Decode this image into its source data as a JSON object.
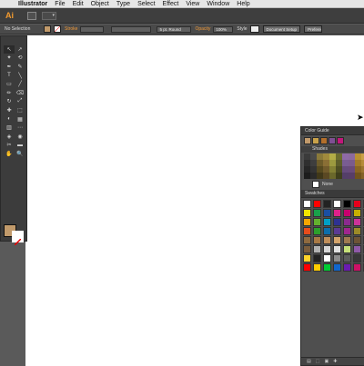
{
  "menubar": {
    "apple_glyph": "",
    "items": [
      "Illustrator",
      "File",
      "Edit",
      "Object",
      "Type",
      "Select",
      "Effect",
      "View",
      "Window",
      "Help"
    ]
  },
  "appbar": {
    "logo": "Ai",
    "arrange_glyph": "▾"
  },
  "control": {
    "selection": "No Selection",
    "stroke_label": "Stroke",
    "brush": "5 pt. Round",
    "opacity_label": "Opacity",
    "opacity_value": "100%",
    "style_label": "Style",
    "doc_setup": "Document Setup",
    "preferences": "Preferen",
    "fill_color": "#c19a6b"
  },
  "tools": [
    "↖",
    "↗",
    "✦",
    "⟲",
    "✒",
    "✎",
    "T",
    "╲",
    "▭",
    "╱",
    "✏",
    "⌫",
    "↻",
    "⤢",
    "✚",
    "⬚",
    "◐",
    "▦",
    "▥",
    "⋯",
    "◈",
    "◉",
    "✂",
    "▬",
    "✋",
    "🔍"
  ],
  "panel": {
    "title": "Color Guide",
    "shades_label": "Shades",
    "none_label": "None",
    "swatches_label": "Swatches",
    "guide_colors": [
      "#c19a6b",
      "#c9a24a",
      "#b36f2b",
      "#7f4f93",
      "#c2187b"
    ],
    "shade_colors": [
      "#3b3b3b",
      "#4a4a4a",
      "#8a7a3a",
      "#a08a3c",
      "#b2ad46",
      "#6b6d2e",
      "#8e6aa6",
      "#8c6a9e",
      "#b99130",
      "#caa048",
      "#2f2f2f",
      "#3e3e3e",
      "#6d5c2a",
      "#8a6f35",
      "#9c9a3f",
      "#5d5e2a",
      "#795d92",
      "#7b5b8d",
      "#a27a29",
      "#b68b3a",
      "#262626",
      "#343434",
      "#564a20",
      "#715b2c",
      "#828034",
      "#4d4e22",
      "#664c7c",
      "#6a4b7a",
      "#8a6622",
      "#9c7530",
      "#1c1c1c",
      "#2a2a2a",
      "#403819",
      "#5a4823",
      "#6a682b",
      "#3e3f1b",
      "#543f69",
      "#583e67",
      "#72541c",
      "#836227"
    ],
    "swatch_colors": [
      "#ffffff",
      "#ff0000",
      "#222222",
      "#ffffff",
      "#000000",
      "#e8001c",
      "#ff3a2e",
      "#f2e600",
      "#19a14a",
      "#1a4fa3",
      "#e0218a",
      "#c7006e",
      "#c8b000",
      "#ff9a00",
      "#f7a600",
      "#63b32e",
      "#00a0c6",
      "#2e3192",
      "#8b2a8f",
      "#cc3399",
      "#ff6600",
      "#e74c1c",
      "#2ca02c",
      "#0d6eab",
      "#5b3a94",
      "#a0268f",
      "#9c8b28",
      "#7f5a2d",
      "#8f6a3f",
      "#a87945",
      "#bf8e5a",
      "#d2a36b",
      "#9f7a50",
      "#6d5436",
      "#4d3a24",
      "#7b5d3d",
      "#b2b2b2",
      "#d6d6d6",
      "#e0e0e0",
      "#c6e07a",
      "#8f5aa8",
      "#6a6a6a",
      "#ffd42a",
      "#222222",
      "#ffffff",
      "#8c8c8c",
      "#5c5c5c",
      "#383838",
      "#1a1a1a",
      "#ff0000",
      "#ffcc00",
      "#00cc33",
      "#1166cc",
      "#6a1bb1",
      "#cc1166",
      "#e5e5e5"
    ]
  }
}
